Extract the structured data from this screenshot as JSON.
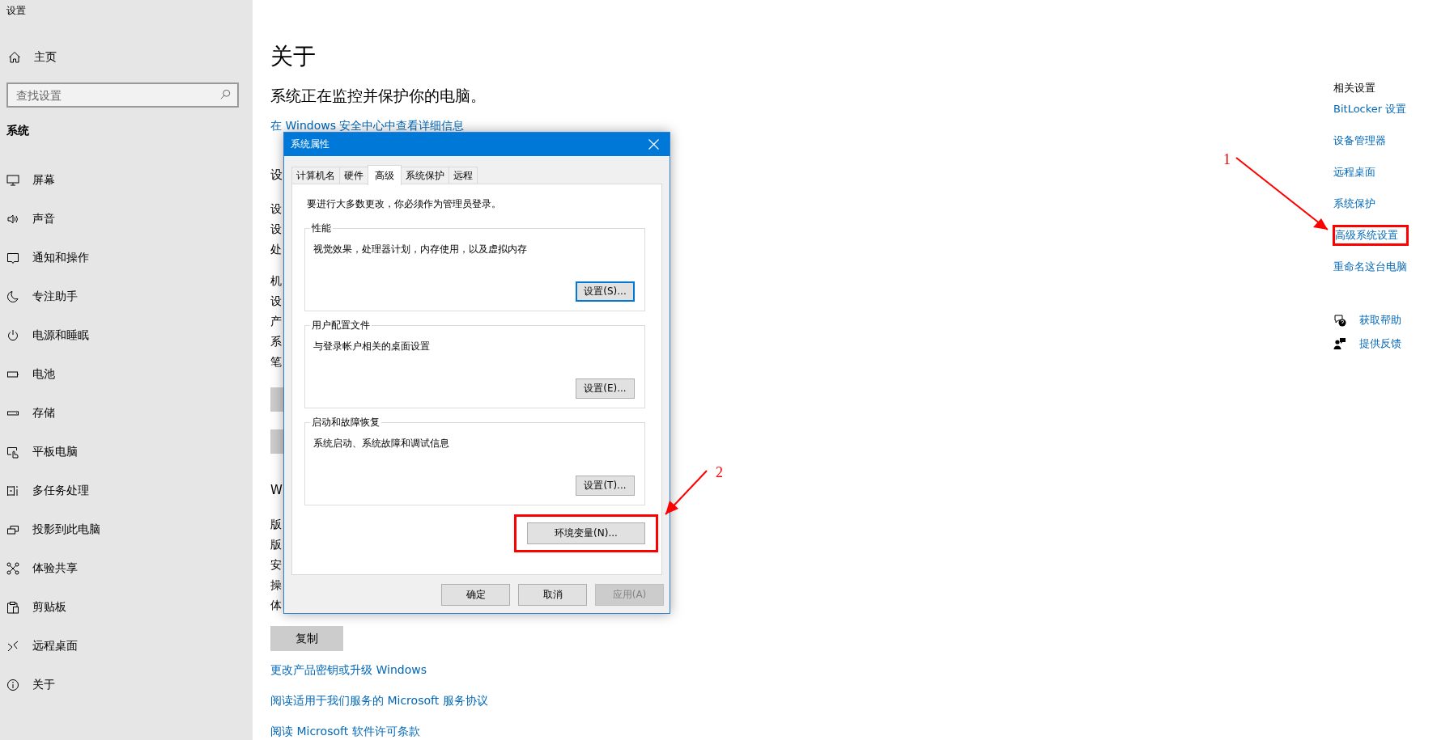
{
  "window": {
    "title": "设置"
  },
  "sidebar": {
    "home": "主页",
    "search": {
      "placeholder": "查找设置"
    },
    "section": "系统",
    "items": [
      {
        "label": "屏幕"
      },
      {
        "label": "声音"
      },
      {
        "label": "通知和操作"
      },
      {
        "label": "专注助手"
      },
      {
        "label": "电源和睡眠"
      },
      {
        "label": "电池"
      },
      {
        "label": "存储"
      },
      {
        "label": "平板电脑"
      },
      {
        "label": "多任务处理"
      },
      {
        "label": "投影到此电脑"
      },
      {
        "label": "体验共享"
      },
      {
        "label": "剪贴板"
      },
      {
        "label": "远程桌面"
      },
      {
        "label": "关于"
      }
    ]
  },
  "main": {
    "title": "关于",
    "subtitle": "系统正在监控并保护你的电脑。",
    "security_link": "在 Windows 安全中心中查看详细信息",
    "covered_blocks": [
      {
        "kind": "heading",
        "text": "设"
      },
      {
        "kind": "lines",
        "lines": [
          "设",
          "设",
          "处"
        ]
      },
      {
        "kind": "lines",
        "lines": [
          "机",
          "设",
          "产",
          "系",
          "笔"
        ]
      },
      {
        "kind": "button"
      },
      {
        "kind": "button"
      },
      {
        "kind": "heading",
        "text": "W"
      },
      {
        "kind": "lines",
        "lines": [
          "版",
          "版",
          "安",
          "操",
          "体"
        ]
      }
    ],
    "copy_button": "复制",
    "links": [
      "更改产品密钥或升级 Windows",
      "阅读适用于我们服务的 Microsoft 服务协议",
      "阅读 Microsoft 软件许可条款"
    ]
  },
  "related": {
    "title": "相关设置",
    "links": [
      {
        "label": "BitLocker 设置",
        "highlighted": false
      },
      {
        "label": "设备管理器",
        "highlighted": false
      },
      {
        "label": "远程桌面",
        "highlighted": false
      },
      {
        "label": "系统保护",
        "highlighted": false
      },
      {
        "label": "高级系统设置",
        "highlighted": true
      },
      {
        "label": "重命名这台电脑",
        "highlighted": false
      }
    ],
    "help": [
      {
        "label": "获取帮助"
      },
      {
        "label": "提供反馈"
      }
    ]
  },
  "dialog": {
    "title": "系统属性",
    "tabs": [
      {
        "label": "计算机名",
        "selected": false
      },
      {
        "label": "硬件",
        "selected": false
      },
      {
        "label": "高级",
        "selected": true
      },
      {
        "label": "系统保护",
        "selected": false
      },
      {
        "label": "远程",
        "selected": false
      }
    ],
    "notice": "要进行大多数更改，你必须作为管理员登录。",
    "groups": [
      {
        "title": "性能",
        "description": "视觉效果，处理器计划，内存使用，以及虚拟内存",
        "button": "设置(S)...",
        "default": true
      },
      {
        "title": "用户配置文件",
        "description": "与登录帐户相关的桌面设置",
        "button": "设置(E)...",
        "default": false
      },
      {
        "title": "启动和故障恢复",
        "description": "系统启动、系统故障和调试信息",
        "button": "设置(T)...",
        "default": false
      }
    ],
    "env_button": {
      "label": "环境变量(N)...",
      "highlighted": true
    },
    "footer": [
      {
        "label": "确定",
        "disabled": false
      },
      {
        "label": "取消",
        "disabled": false
      },
      {
        "label": "应用(A)",
        "disabled": true
      }
    ]
  },
  "annotations": [
    {
      "label": "1"
    },
    {
      "label": "2"
    }
  ]
}
